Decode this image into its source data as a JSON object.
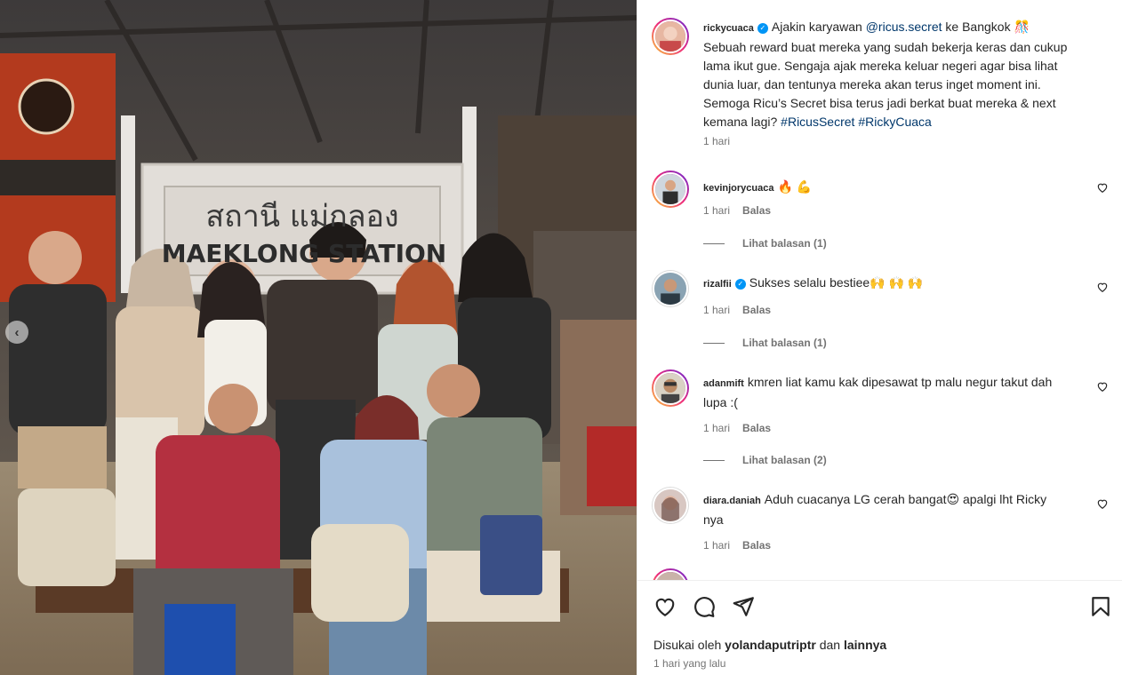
{
  "photo": {
    "sign_thai": "สถานี แม่กลอง",
    "sign_latin": "MAEKLONG STATION",
    "prev_icon": "chevron-left-icon"
  },
  "caption": {
    "username": "rickycuaca",
    "verified": true,
    "text_before": "Ajakin karyawan",
    "mention": "@ricus.secret",
    "text_after": "ke Bangkok 🎊 Sebuah reward buat mereka yang sudah bekerja keras dan cukup lama ikut gue. Sengaja ajak mereka keluar negeri agar bisa lihat dunia luar, dan tentunya mereka akan terus inget moment ini. Semoga Ricu’s Secret bisa terus jadi berkat buat mereka & next kemana lagi?",
    "hashtags": [
      "#RicusSecret",
      "#RickyCuaca"
    ],
    "time": "1 hari"
  },
  "comments": [
    {
      "username": "kevinjorycuaca",
      "verified": false,
      "text": "🔥 💪",
      "time": "1 hari",
      "reply": "Balas",
      "view_replies": "Lihat balasan (1)"
    },
    {
      "username": "rizalfii",
      "verified": true,
      "text": "Sukses selalu bestiee🙌 🙌 🙌",
      "time": "1 hari",
      "reply": "Balas",
      "view_replies": "Lihat balasan (1)"
    },
    {
      "username": "adanmift",
      "verified": false,
      "text": "kmren liat kamu kak dipesawat tp malu negur takut dah lupa :(",
      "time": "1 hari",
      "reply": "Balas",
      "view_replies": "Lihat balasan (2)"
    },
    {
      "username": "diara.daniah",
      "verified": false,
      "text": "Aduh cuacanya LG cerah bangat😍 apalgi lht Ricky nya",
      "time": "1 hari",
      "reply": "Balas",
      "view_replies": ""
    }
  ],
  "actions": {
    "like_icon": "heart-icon",
    "comment_icon": "comment-icon",
    "share_icon": "send-icon",
    "save_icon": "bookmark-icon",
    "liked_by_prefix": "Disukai oleh",
    "liked_by_user": "yolandaputriptr",
    "liked_by_and": "dan",
    "liked_by_others": "lainnya",
    "timestamp": "1 hari yang lalu"
  }
}
